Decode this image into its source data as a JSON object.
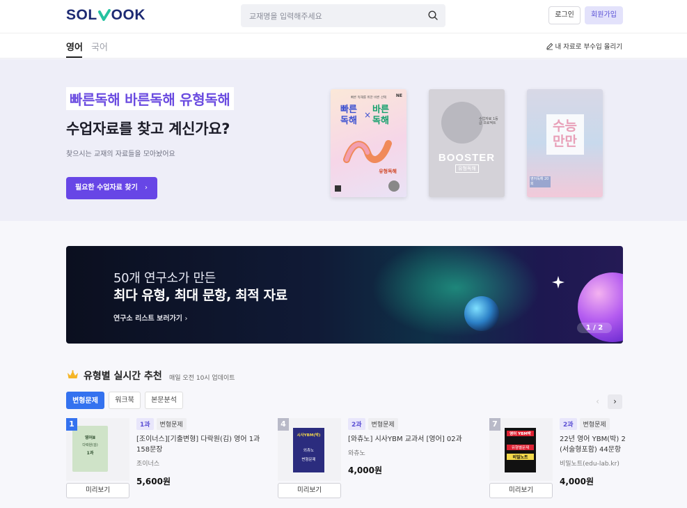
{
  "header": {
    "logo_pre": "SOL",
    "logo_post": "OOK",
    "search_placeholder": "교재명을 입력해주세요",
    "login_label": "로그인",
    "join_label": "회원가입"
  },
  "nav": {
    "tabs": [
      {
        "label": "영어"
      },
      {
        "label": "국어"
      }
    ],
    "upload_label": "내 자료로 부수입 올리기"
  },
  "hero": {
    "highlight": "빠른독해 바른독해 유형독해",
    "title": "수업자료를 찾고 계신가요?",
    "subtitle": "찾으시는 교재의 자료들을 모아놨어요",
    "cta_label": "필요한 수업자료 찾기",
    "books": [
      {
        "top_text": "빠른 독해를 위한 바른 선택",
        "big1": "빠른",
        "big2": "바른",
        "big3": "독해",
        "big4": "독해",
        "series": "유형독해",
        "badge": "NE"
      },
      {
        "mid": "수업자료 1등급 프로젝트",
        "title": "BOOSTER",
        "sub": "유형독해"
      },
      {
        "title1": "수능",
        "title2": "만만",
        "sub": "영어독해 20회"
      }
    ]
  },
  "banner": {
    "line1": "50개 연구소가 만든",
    "line2": "최다 유형, 최대 문항, 최적 자료",
    "link": "연구소 리스트 보러가기",
    "pager": "1 / 2"
  },
  "recommend": {
    "title": "유형별 실시간 추천",
    "subtitle": "매일 오전 10시 업데이트",
    "chips": [
      "변형문제",
      "워크북",
      "본문분석"
    ],
    "preview_label": "미리보기",
    "items": [
      {
        "rank": "1",
        "tag1": "1과",
        "tag2": "변형문제",
        "title": "[조이너스][기출변형] 다락원(김) 영어 1과\n158문장",
        "publisher": "조이너스",
        "price": "5,600원",
        "rank_color": "#3472ef",
        "cover_l1": "영어Ⅱ",
        "cover_l2": "다락원(김)",
        "cover_l3": "1과"
      },
      {
        "rank": "4",
        "tag1": "2과",
        "tag2": "변형문제",
        "title": "[와츄노] 시사YBM 교과서 [영어] 02과",
        "publisher": "와츄노",
        "price": "4,000원",
        "rank_color": "#b9bac8",
        "cover_l1": "시사YBM(박)",
        "cover_l2": "외츄노",
        "cover_l3": "변형문제"
      },
      {
        "rank": "7",
        "tag1": "2과",
        "tag2": "변형문제",
        "title": "22년 영어 YBM(박) 2\n(서술형포함) 44문항",
        "publisher": "비밀노트(edu-lab.kr)",
        "price": "4,000원",
        "rank_color": "#b9bac8",
        "cover_l1": "영어 YBM박",
        "cover_l2": "유형별문제",
        "cover_l3": "비밀노트"
      }
    ]
  }
}
